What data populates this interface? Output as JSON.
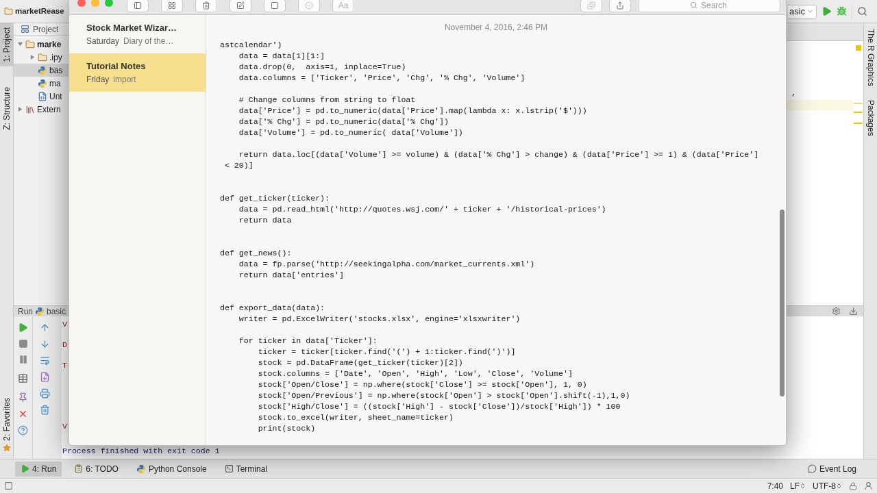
{
  "ide": {
    "project_title": "marketRease",
    "run_config": "asic",
    "left_strip": [
      {
        "label": "1: Project",
        "selected": true
      },
      {
        "label": "Z: Structure",
        "selected": false
      },
      {
        "label": "2: Favorites",
        "selected": false
      }
    ],
    "project_panel": {
      "title": "Project",
      "tree": [
        {
          "label": "marke",
          "kind": "folder",
          "expanded": true,
          "selected": false,
          "children": [
            {
              "label": ".ipy",
              "kind": "folder",
              "expanded": false,
              "selected": false
            },
            {
              "label": "bas",
              "kind": "python",
              "selected": true
            },
            {
              "label": "ma",
              "kind": "python",
              "selected": false
            },
            {
              "label": "Unt",
              "kind": "notebook",
              "selected": false
            }
          ]
        },
        {
          "label": "Extern",
          "kind": "library",
          "expanded": false,
          "selected": false
        }
      ]
    },
    "editor_fragment": ",",
    "run_panel": {
      "title": "Run",
      "config": "basic",
      "output_top": [
        {
          "text": "V",
          "kind": "error"
        },
        {
          "text": "D",
          "kind": "error"
        },
        {
          "text": "T",
          "kind": "error"
        }
      ],
      "output_bottom": [
        {
          "text": "V",
          "kind": "error"
        },
        {
          "text": "Process finished with exit code 1",
          "kind": "info"
        }
      ]
    },
    "right_strip": [
      {
        "label": "The R Graphics"
      },
      {
        "label": "Packages"
      }
    ],
    "bottom_tabs": [
      {
        "label": "4: Run",
        "kind": "run",
        "selected": true
      },
      {
        "label": "6: TODO",
        "kind": "todo",
        "selected": false
      },
      {
        "label": "Python Console",
        "kind": "python",
        "selected": false
      },
      {
        "label": "Terminal",
        "kind": "terminal",
        "selected": false
      }
    ],
    "event_log": "Event Log",
    "status": {
      "position": "7:40",
      "line_separator": "LF",
      "encoding": "UTF-8"
    }
  },
  "notes_app": {
    "format_label": "Aa",
    "search_placeholder": "Search",
    "notes": [
      {
        "title": "Stock Market Wizar…",
        "date": "Saturday",
        "preview": "Diary of the…",
        "selected": false
      },
      {
        "title": "Tutorial Notes",
        "date": "Friday",
        "preview": "import",
        "selected": true
      }
    ],
    "note": {
      "timestamp": "November 4, 2016, 2:46 PM",
      "code": [
        {
          "paragraphs": [
            [
              "astcalendar')",
              "    data = data[1][1:]",
              "    data.drop(0,  axis=1, inplace=True)",
              "    data.columns = ['Ticker', 'Price', 'Chg', '% Chg', 'Volume']"
            ],
            [
              "    # Change columns from string to float",
              "    data['Price'] = pd.to_numeric(data['Price'].map(lambda x: x.lstrip('$')))",
              "    data['% Chg'] = pd.to_numeric(data['% Chg'])",
              "    data['Volume'] = pd.to_numeric( data['Volume'])"
            ],
            [
              "    return data.loc[(data['Volume'] >= volume) & (data['% Chg'] > change) & (data['Price'] >= 1) & (data['Price']",
              " < 20)]"
            ]
          ]
        },
        {
          "paragraphs": [
            [
              "def get_ticker(ticker):",
              "    data = pd.read_html('http://quotes.wsj.com/' + ticker + '/historical-prices')",
              "    return data"
            ]
          ]
        },
        {
          "paragraphs": [
            [
              "def get_news():",
              "    data = fp.parse('http://seekingalpha.com/market_currents.xml')",
              "    return data['entries']"
            ]
          ]
        },
        {
          "paragraphs": [
            [
              "def export_data(data):",
              "    writer = pd.ExcelWriter('stocks.xlsx', engine='xlsxwriter')"
            ],
            [
              "    for ticker in data['Ticker']:",
              "        ticker = ticker[ticker.find('(') + 1:ticker.find(')')]",
              "        stock = pd.DataFrame(get_ticker(ticker)[2])",
              "        stock.columns = ['Date', 'Open', 'High', 'Low', 'Close', 'Volume']",
              "        stock['Open/Close'] = np.where(stock['Close'] >= stock['Open'], 1, 0)",
              "        stock['Open/Previous'] = np.where(stock['Open'] > stock['Open'].shift(-1),1,0)",
              "        stock['High/Close'] = ((stock['High'] - stock['Close'])/stock['High']) * 100",
              "        stock.to_excel(writer, sheet_name=ticker)",
              "        print(stock)"
            ]
          ]
        }
      ]
    }
  }
}
